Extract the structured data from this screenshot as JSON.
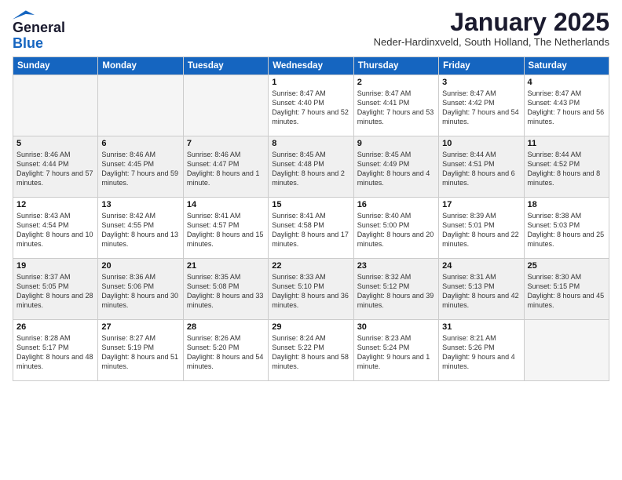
{
  "header": {
    "logo_line1": "General",
    "logo_line2": "Blue",
    "month": "January 2025",
    "location": "Neder-Hardinxveld, South Holland, The Netherlands"
  },
  "weekdays": [
    "Sunday",
    "Monday",
    "Tuesday",
    "Wednesday",
    "Thursday",
    "Friday",
    "Saturday"
  ],
  "weeks": [
    [
      {
        "day": "",
        "info": ""
      },
      {
        "day": "",
        "info": ""
      },
      {
        "day": "",
        "info": ""
      },
      {
        "day": "1",
        "info": "Sunrise: 8:47 AM\nSunset: 4:40 PM\nDaylight: 7 hours and 52 minutes."
      },
      {
        "day": "2",
        "info": "Sunrise: 8:47 AM\nSunset: 4:41 PM\nDaylight: 7 hours and 53 minutes."
      },
      {
        "day": "3",
        "info": "Sunrise: 8:47 AM\nSunset: 4:42 PM\nDaylight: 7 hours and 54 minutes."
      },
      {
        "day": "4",
        "info": "Sunrise: 8:47 AM\nSunset: 4:43 PM\nDaylight: 7 hours and 56 minutes."
      }
    ],
    [
      {
        "day": "5",
        "info": "Sunrise: 8:46 AM\nSunset: 4:44 PM\nDaylight: 7 hours and 57 minutes."
      },
      {
        "day": "6",
        "info": "Sunrise: 8:46 AM\nSunset: 4:45 PM\nDaylight: 7 hours and 59 minutes."
      },
      {
        "day": "7",
        "info": "Sunrise: 8:46 AM\nSunset: 4:47 PM\nDaylight: 8 hours and 1 minute."
      },
      {
        "day": "8",
        "info": "Sunrise: 8:45 AM\nSunset: 4:48 PM\nDaylight: 8 hours and 2 minutes."
      },
      {
        "day": "9",
        "info": "Sunrise: 8:45 AM\nSunset: 4:49 PM\nDaylight: 8 hours and 4 minutes."
      },
      {
        "day": "10",
        "info": "Sunrise: 8:44 AM\nSunset: 4:51 PM\nDaylight: 8 hours and 6 minutes."
      },
      {
        "day": "11",
        "info": "Sunrise: 8:44 AM\nSunset: 4:52 PM\nDaylight: 8 hours and 8 minutes."
      }
    ],
    [
      {
        "day": "12",
        "info": "Sunrise: 8:43 AM\nSunset: 4:54 PM\nDaylight: 8 hours and 10 minutes."
      },
      {
        "day": "13",
        "info": "Sunrise: 8:42 AM\nSunset: 4:55 PM\nDaylight: 8 hours and 13 minutes."
      },
      {
        "day": "14",
        "info": "Sunrise: 8:41 AM\nSunset: 4:57 PM\nDaylight: 8 hours and 15 minutes."
      },
      {
        "day": "15",
        "info": "Sunrise: 8:41 AM\nSunset: 4:58 PM\nDaylight: 8 hours and 17 minutes."
      },
      {
        "day": "16",
        "info": "Sunrise: 8:40 AM\nSunset: 5:00 PM\nDaylight: 8 hours and 20 minutes."
      },
      {
        "day": "17",
        "info": "Sunrise: 8:39 AM\nSunset: 5:01 PM\nDaylight: 8 hours and 22 minutes."
      },
      {
        "day": "18",
        "info": "Sunrise: 8:38 AM\nSunset: 5:03 PM\nDaylight: 8 hours and 25 minutes."
      }
    ],
    [
      {
        "day": "19",
        "info": "Sunrise: 8:37 AM\nSunset: 5:05 PM\nDaylight: 8 hours and 28 minutes."
      },
      {
        "day": "20",
        "info": "Sunrise: 8:36 AM\nSunset: 5:06 PM\nDaylight: 8 hours and 30 minutes."
      },
      {
        "day": "21",
        "info": "Sunrise: 8:35 AM\nSunset: 5:08 PM\nDaylight: 8 hours and 33 minutes."
      },
      {
        "day": "22",
        "info": "Sunrise: 8:33 AM\nSunset: 5:10 PM\nDaylight: 8 hours and 36 minutes."
      },
      {
        "day": "23",
        "info": "Sunrise: 8:32 AM\nSunset: 5:12 PM\nDaylight: 8 hours and 39 minutes."
      },
      {
        "day": "24",
        "info": "Sunrise: 8:31 AM\nSunset: 5:13 PM\nDaylight: 8 hours and 42 minutes."
      },
      {
        "day": "25",
        "info": "Sunrise: 8:30 AM\nSunset: 5:15 PM\nDaylight: 8 hours and 45 minutes."
      }
    ],
    [
      {
        "day": "26",
        "info": "Sunrise: 8:28 AM\nSunset: 5:17 PM\nDaylight: 8 hours and 48 minutes."
      },
      {
        "day": "27",
        "info": "Sunrise: 8:27 AM\nSunset: 5:19 PM\nDaylight: 8 hours and 51 minutes."
      },
      {
        "day": "28",
        "info": "Sunrise: 8:26 AM\nSunset: 5:20 PM\nDaylight: 8 hours and 54 minutes."
      },
      {
        "day": "29",
        "info": "Sunrise: 8:24 AM\nSunset: 5:22 PM\nDaylight: 8 hours and 58 minutes."
      },
      {
        "day": "30",
        "info": "Sunrise: 8:23 AM\nSunset: 5:24 PM\nDaylight: 9 hours and 1 minute."
      },
      {
        "day": "31",
        "info": "Sunrise: 8:21 AM\nSunset: 5:26 PM\nDaylight: 9 hours and 4 minutes."
      },
      {
        "day": "",
        "info": ""
      }
    ]
  ]
}
